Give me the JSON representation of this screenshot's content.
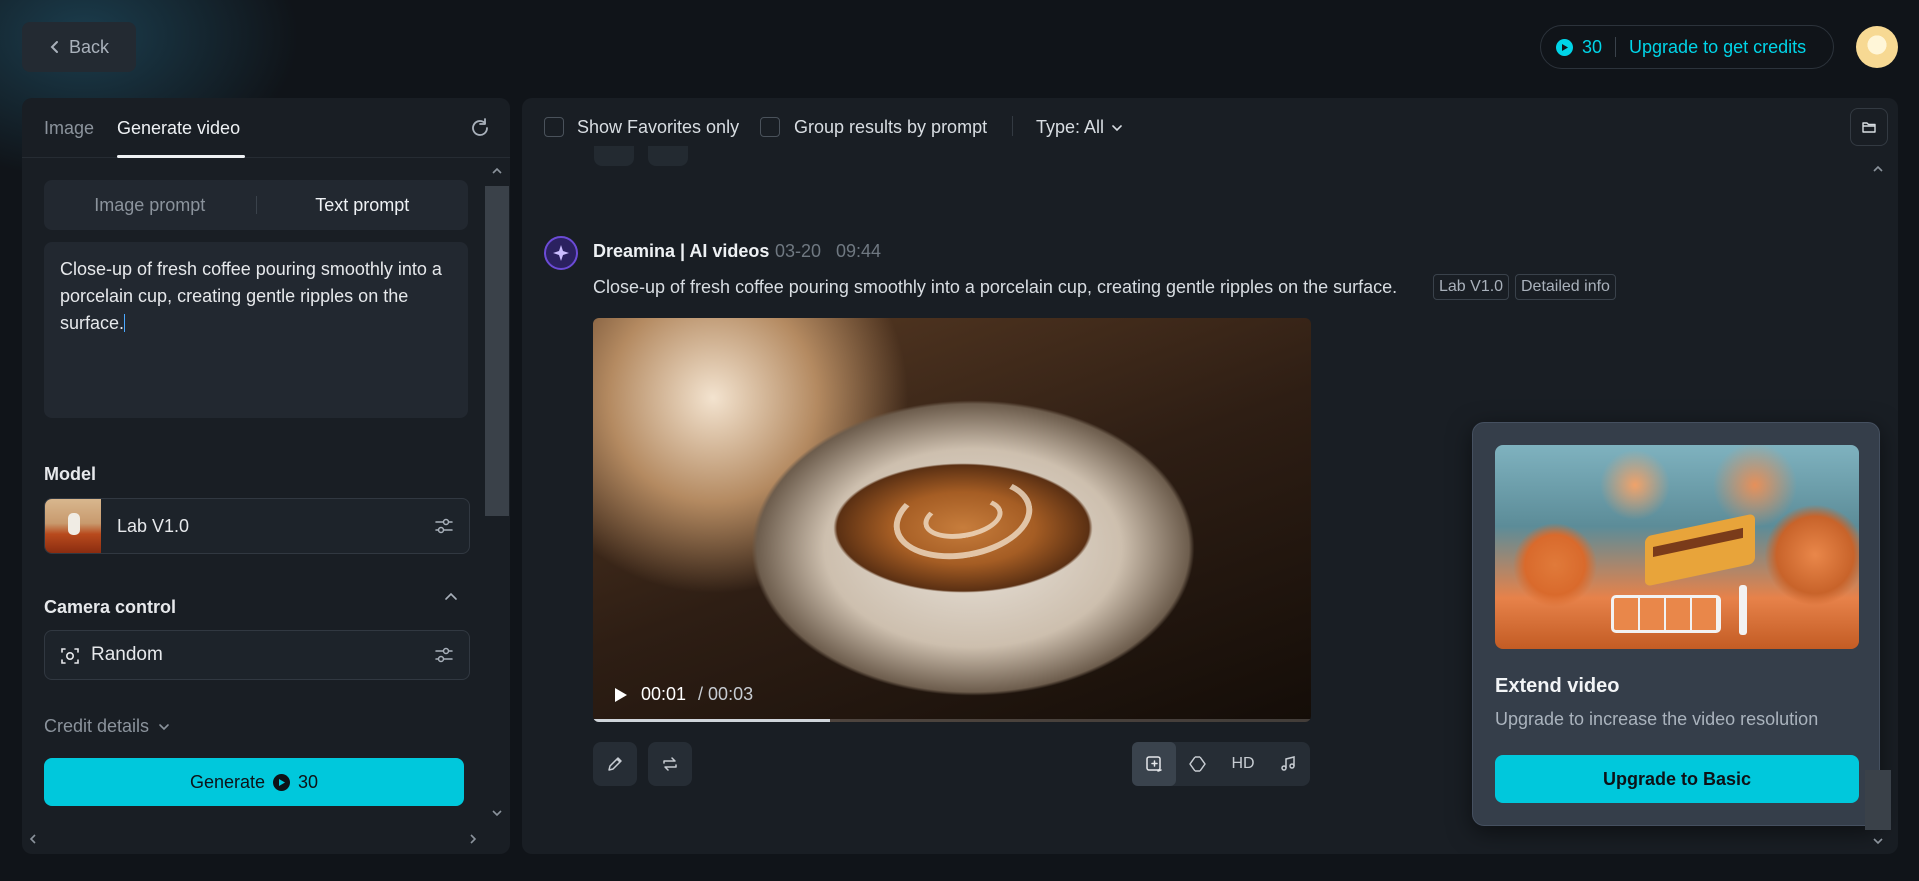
{
  "header": {
    "back_label": "Back",
    "credits": "30",
    "upgrade_label": "Upgrade to get credits"
  },
  "left_panel": {
    "tabs": [
      {
        "label": "Image",
        "active": false
      },
      {
        "label": "Generate video",
        "active": true
      }
    ],
    "prompt_modes": [
      {
        "label": "Image prompt",
        "active": false
      },
      {
        "label": "Text prompt",
        "active": true
      }
    ],
    "prompt_text": "Close-up of fresh coffee pouring smoothly into a porcelain cup, creating gentle ripples on the surface.",
    "model_label": "Model",
    "model_name": "Lab V1.0",
    "camera_label": "Camera control",
    "camera_value": "Random",
    "credit_details_label": "Credit details",
    "generate_label": "Generate",
    "generate_cost": "30"
  },
  "right_panel": {
    "filters": {
      "favorites_label": "Show Favorites only",
      "favorites_checked": false,
      "group_label": "Group results by prompt",
      "group_checked": false,
      "type_label": "Type: All"
    },
    "result": {
      "author": "Dreamina | AI videos",
      "date": "03-20",
      "time": "09:44",
      "prompt": "Close-up of fresh coffee pouring smoothly into a porcelain cup, creating gentle ripples on the surface.",
      "tags": [
        "Lab V1.0",
        "Detailed info"
      ],
      "video": {
        "current_time": "00:01",
        "duration": "/ 00:03",
        "progress_fraction": 0.33
      },
      "tools": [
        {
          "name": "extend-video-icon",
          "active": true
        },
        {
          "name": "frame-interpolation-icon",
          "active": false
        },
        {
          "name": "hd",
          "label": "HD",
          "active": false
        },
        {
          "name": "music-note-icon",
          "active": false
        }
      ]
    },
    "popup": {
      "title": "Extend video",
      "subtitle": "Upgrade to increase the video resolution",
      "button_label": "Upgrade to Basic"
    }
  },
  "colors": {
    "accent": "#00c8dc",
    "background": "#101419",
    "panel": "#191e24",
    "popup": "#353e4a"
  }
}
